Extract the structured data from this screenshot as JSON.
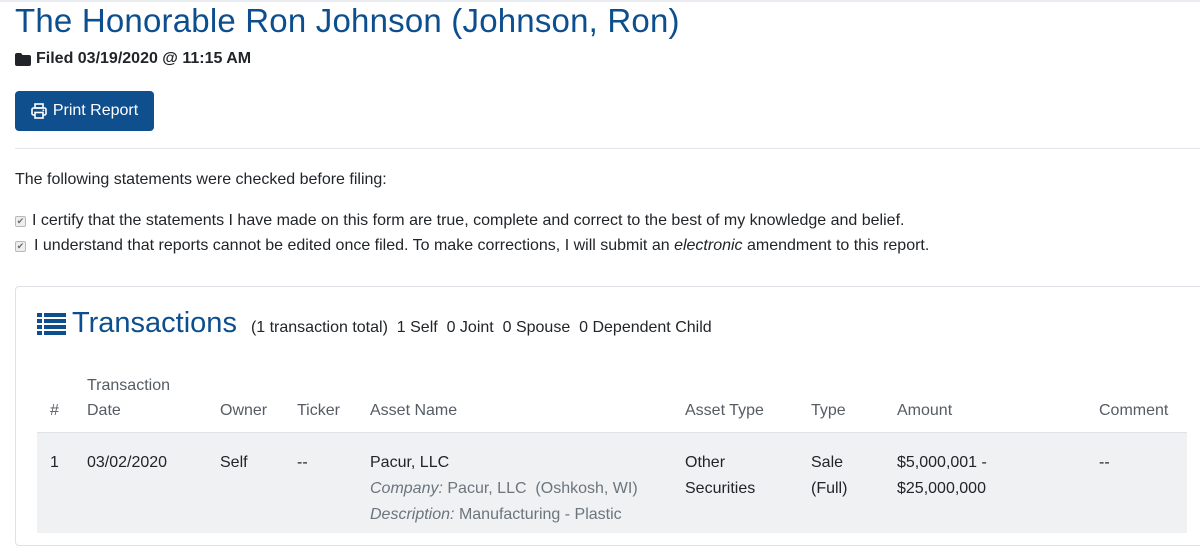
{
  "report": {
    "title": "The Honorable Ron Johnson (Johnson, Ron)",
    "filed": "Filed 03/19/2020 @ 11:15 AM",
    "print_label": "Print Report"
  },
  "statements": {
    "intro": "The following statements were checked before filing:",
    "items": [
      "I certify that the statements I have made on this form are true, complete and correct to the best of my knowledge and belief.",
      "I understand that reports cannot be edited once filed. To make corrections, I will submit an"
    ],
    "item2_italic": "electronic",
    "item2_suffix": "amendment to this report."
  },
  "transactions": {
    "heading": "Transactions",
    "summary": "(1 transaction total)  1 Self  0 Joint  0 Spouse  0 Dependent Child",
    "columns": {
      "num": "#",
      "date_line1": "Transaction",
      "date_line2": "Date",
      "owner": "Owner",
      "ticker": "Ticker",
      "asset_name": "Asset Name",
      "asset_type": "Asset Type",
      "type": "Type",
      "amount": "Amount",
      "comment": "Comment"
    },
    "rows": [
      {
        "num": "1",
        "date": "03/02/2020",
        "owner": "Self",
        "ticker": "--",
        "asset_name": "Pacur, LLC",
        "company_label": "Company:",
        "company_value": "Pacur, LLC  (Oshkosh, WI)",
        "description_label": "Description:",
        "description_value": "Manufacturing - Plastic",
        "asset_type_line1": "Other",
        "asset_type_line2": "Securities",
        "type_line1": "Sale",
        "type_line2": "(Full)",
        "amount_line1": "$5,000,001 -",
        "amount_line2": "$25,000,000",
        "comment": "--"
      }
    ]
  },
  "colors": {
    "title_blue": "#0c4e8e",
    "button_blue": "#0f4f8e",
    "row_bg": "#eff1f3"
  },
  "icons": {
    "filed": "folder-icon",
    "print": "print-icon",
    "transactions": "list-icon",
    "checkbox": "checkmark-icon"
  }
}
